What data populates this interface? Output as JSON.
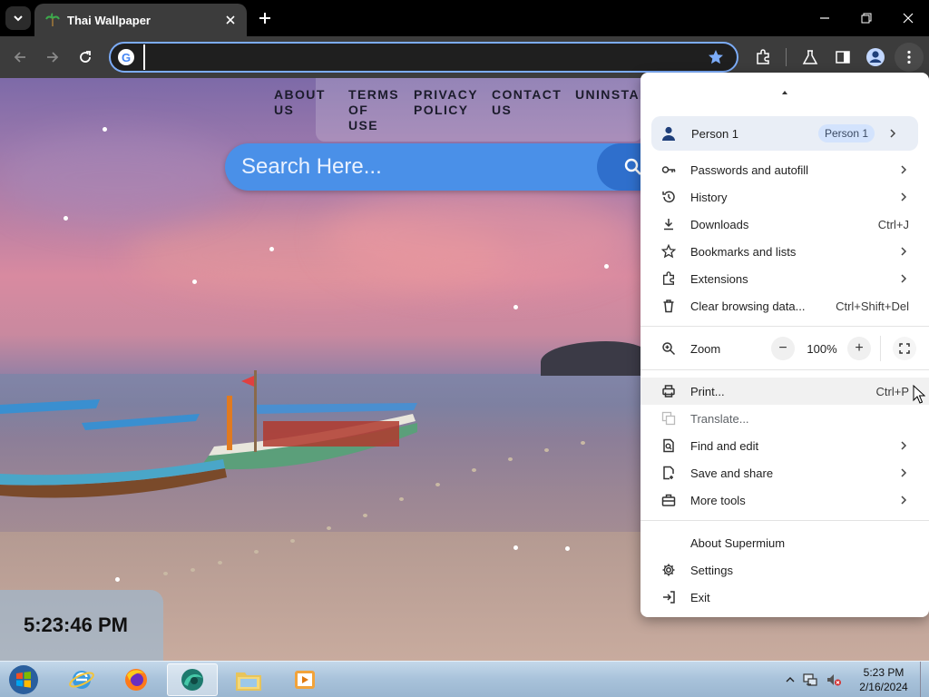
{
  "browser": {
    "tab_title": "Thai Wallpaper",
    "address_value": "",
    "zoom_label": "Zoom",
    "zoom_value": "100%",
    "zoom_minus": "−",
    "zoom_plus": "+"
  },
  "site": {
    "nav": [
      {
        "label": "ABOUT US"
      },
      {
        "label": "TERMS OF USE"
      },
      {
        "label": "PRIVACY POLICY"
      },
      {
        "label": "CONTACT US"
      },
      {
        "label": "UNINSTALL"
      }
    ],
    "search_placeholder": "Search Here...",
    "clock": "5:23:46 PM"
  },
  "menu": {
    "profile_name": "Person 1",
    "profile_badge": "Person 1",
    "items": [
      {
        "label": "Passwords and autofill",
        "shortcut": "",
        "icon": "key-icon"
      },
      {
        "label": "History",
        "shortcut": "",
        "icon": "history-icon"
      },
      {
        "label": "Downloads",
        "shortcut": "Ctrl+J",
        "icon": "download-icon"
      },
      {
        "label": "Bookmarks and lists",
        "shortcut": "",
        "icon": "star-icon"
      },
      {
        "label": "Extensions",
        "shortcut": "",
        "icon": "puzzle-icon"
      },
      {
        "label": "Clear browsing data...",
        "shortcut": "Ctrl+Shift+Del",
        "icon": "trash-icon"
      }
    ],
    "items2": [
      {
        "label": "Print...",
        "shortcut": "Ctrl+P",
        "icon": "printer-icon"
      },
      {
        "label": "Translate...",
        "shortcut": "",
        "icon": "translate-icon"
      },
      {
        "label": "Find and edit",
        "shortcut": "",
        "icon": "find-icon"
      },
      {
        "label": "Save and share",
        "shortcut": "",
        "icon": "save-share-icon"
      },
      {
        "label": "More tools",
        "shortcut": "",
        "icon": "toolbox-icon"
      }
    ],
    "items3": [
      {
        "label": "About Supermium",
        "icon": ""
      },
      {
        "label": "Settings",
        "icon": "gear-icon"
      },
      {
        "label": "Exit",
        "icon": "exit-icon"
      }
    ]
  },
  "taskbar": {
    "time": "5:23 PM",
    "date": "2/16/2024"
  }
}
